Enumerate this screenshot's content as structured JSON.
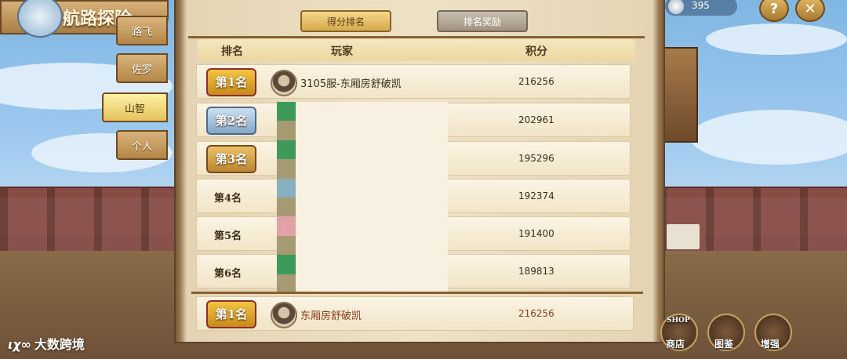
{
  "game_title": "航路探险",
  "side_tabs": [
    {
      "label": "路飞",
      "active": false
    },
    {
      "label": "佐罗",
      "active": false
    },
    {
      "label": "山智",
      "active": true
    },
    {
      "label": "个人",
      "active": false
    }
  ],
  "tabs": {
    "score_ranking": "得分排名",
    "ranking_rewards": "排名奖励"
  },
  "headers": {
    "rank": "排名",
    "player": "玩家",
    "points": "积分"
  },
  "rows": [
    {
      "rank": "第1名",
      "player": "3105服-东厢房舒破凯",
      "points": "216256"
    },
    {
      "rank": "第2名",
      "player": "",
      "points": "202961"
    },
    {
      "rank": "第3名",
      "player": "",
      "points": "195296"
    },
    {
      "rank": "第4名",
      "player": "",
      "points": "192374"
    },
    {
      "rank": "第5名",
      "player": "",
      "points": "191400"
    },
    {
      "rank": "第6名",
      "player": "",
      "points": "189813"
    }
  ],
  "self_row": {
    "rank": "第1名",
    "player": "东厢房舒破凯",
    "points": "216256"
  },
  "currency": {
    "value": "395"
  },
  "top_buttons": {
    "help": "?",
    "close": "✕"
  },
  "bottom_buttons": {
    "shop_tag": "SHOP",
    "shop": "商店",
    "atlas": "图鉴",
    "boost": "增强"
  },
  "watermark": "大数跨境",
  "colors": {
    "accent": "#d7a94c",
    "self_text": "#8a3b1e"
  }
}
